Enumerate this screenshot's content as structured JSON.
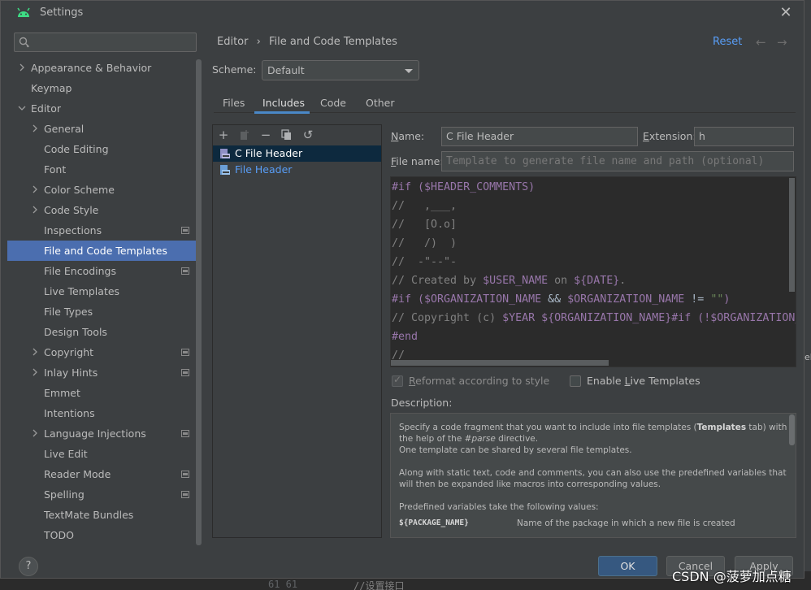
{
  "window": {
    "title": "Settings"
  },
  "search": {
    "placeholder": ""
  },
  "nav": {
    "items": [
      {
        "label": "Appearance & Behavior",
        "arrow": "right",
        "indent": 0
      },
      {
        "label": "Keymap",
        "arrow": "",
        "indent": 0
      },
      {
        "label": "Editor",
        "arrow": "down",
        "indent": 0
      },
      {
        "label": "General",
        "arrow": "right",
        "indent": 1
      },
      {
        "label": "Code Editing",
        "arrow": "",
        "indent": 1
      },
      {
        "label": "Font",
        "arrow": "",
        "indent": 1
      },
      {
        "label": "Color Scheme",
        "arrow": "right",
        "indent": 1
      },
      {
        "label": "Code Style",
        "arrow": "right",
        "indent": 1
      },
      {
        "label": "Inspections",
        "arrow": "",
        "indent": 1,
        "project": true
      },
      {
        "label": "File and Code Templates",
        "arrow": "",
        "indent": 1,
        "selected": true
      },
      {
        "label": "File Encodings",
        "arrow": "",
        "indent": 1,
        "project": true
      },
      {
        "label": "Live Templates",
        "arrow": "",
        "indent": 1
      },
      {
        "label": "File Types",
        "arrow": "",
        "indent": 1
      },
      {
        "label": "Design Tools",
        "arrow": "",
        "indent": 1
      },
      {
        "label": "Copyright",
        "arrow": "right",
        "indent": 1,
        "project": true
      },
      {
        "label": "Inlay Hints",
        "arrow": "right",
        "indent": 1,
        "project": true
      },
      {
        "label": "Emmet",
        "arrow": "",
        "indent": 1
      },
      {
        "label": "Intentions",
        "arrow": "",
        "indent": 1
      },
      {
        "label": "Language Injections",
        "arrow": "right",
        "indent": 1,
        "project": true
      },
      {
        "label": "Live Edit",
        "arrow": "",
        "indent": 1
      },
      {
        "label": "Reader Mode",
        "arrow": "",
        "indent": 1,
        "project": true
      },
      {
        "label": "Spelling",
        "arrow": "",
        "indent": 1,
        "project": true
      },
      {
        "label": "TextMate Bundles",
        "arrow": "",
        "indent": 1
      },
      {
        "label": "TODO",
        "arrow": "",
        "indent": 1
      }
    ]
  },
  "breadcrumb": {
    "parent": "Editor",
    "separator": "›",
    "current": "File and Code Templates"
  },
  "header": {
    "reset": "Reset"
  },
  "scheme": {
    "label": "Scheme:",
    "value": "Default"
  },
  "tabs": {
    "files": "Files",
    "includes": "Includes",
    "code": "Code",
    "other": "Other",
    "active": "Includes"
  },
  "templates": [
    {
      "name": "C File Header",
      "selected": true
    },
    {
      "name": "File Header",
      "selected": false
    }
  ],
  "form": {
    "name_label_u": "N",
    "name_label_rest": "ame:",
    "name_value": "C File Header",
    "ext_label_u": "E",
    "ext_label_rest": "xtension:",
    "ext_value": "h",
    "fname_label_u": "F",
    "fname_label_rest": "ile name:",
    "fname_placeholder": "Template to generate file name and path (optional)"
  },
  "code": {
    "l1a": "#if (",
    "l1b": "$HEADER_COMMENTS",
    "l1c": ")",
    "l2": "//   ,___,",
    "l3": "//   [O.o]",
    "l4": "//   /)  )",
    "l5": "//  -\"--\"-",
    "l6a": "// Created by ",
    "l6b": "$USER_NAME",
    "l6c": " on ",
    "l6d": "${DATE}",
    "l6e": ".",
    "l7a": "#if (",
    "l7b": "$ORGANIZATION_NAME",
    "l7c": " && ",
    "l7d": "$ORGANIZATION_NAME",
    "l7e": " != ",
    "l7f": "\"\"",
    "l7g": ")",
    "l8a": "// Copyright (c) ",
    "l8b": "$YEAR",
    "l8c": " ",
    "l8d": "${ORGANIZATION_NAME}",
    "l8e": "#if (!",
    "l8f": "$ORGANIZATION_",
    "l9": "#end",
    "l10": "//"
  },
  "options": {
    "reformat_u": "R",
    "reformat_rest": "eformat according to style",
    "reformat_checked": true,
    "live_pre": "Enable ",
    "live_u": "L",
    "live_rest": "ive Templates",
    "live_checked": false
  },
  "description": {
    "label": "Description:",
    "p1a": "Specify a code fragment that you want to include into file templates (",
    "p1b": "Templates",
    "p1c": " tab) with the help of the ",
    "p1d": "#parse",
    "p1e": " directive.",
    "p1f": "One template can be shared by several file templates.",
    "p2": "Along with static text, code and comments, you can also use the predefined variables that will then be expanded like macros into corresponding values.",
    "p3": "Predefined variables take the following values:",
    "var_name": "${PACKAGE_NAME}",
    "var_desc": "Name of the package in which a new file is created"
  },
  "footer": {
    "help": "?",
    "ok": "OK",
    "cancel": "Cancel",
    "apply": "Apply"
  },
  "background": {
    "line_numbers": "61  61",
    "comment": "//设置接口",
    "side_text": "ek"
  },
  "watermark": "CSDN @菠萝加点糖",
  "colors": {
    "accent": "#4b6eaf",
    "link": "#589df6",
    "ok_button": "#365880",
    "keyword": "#9876aa",
    "comment": "#808080",
    "string": "#6a8759"
  }
}
